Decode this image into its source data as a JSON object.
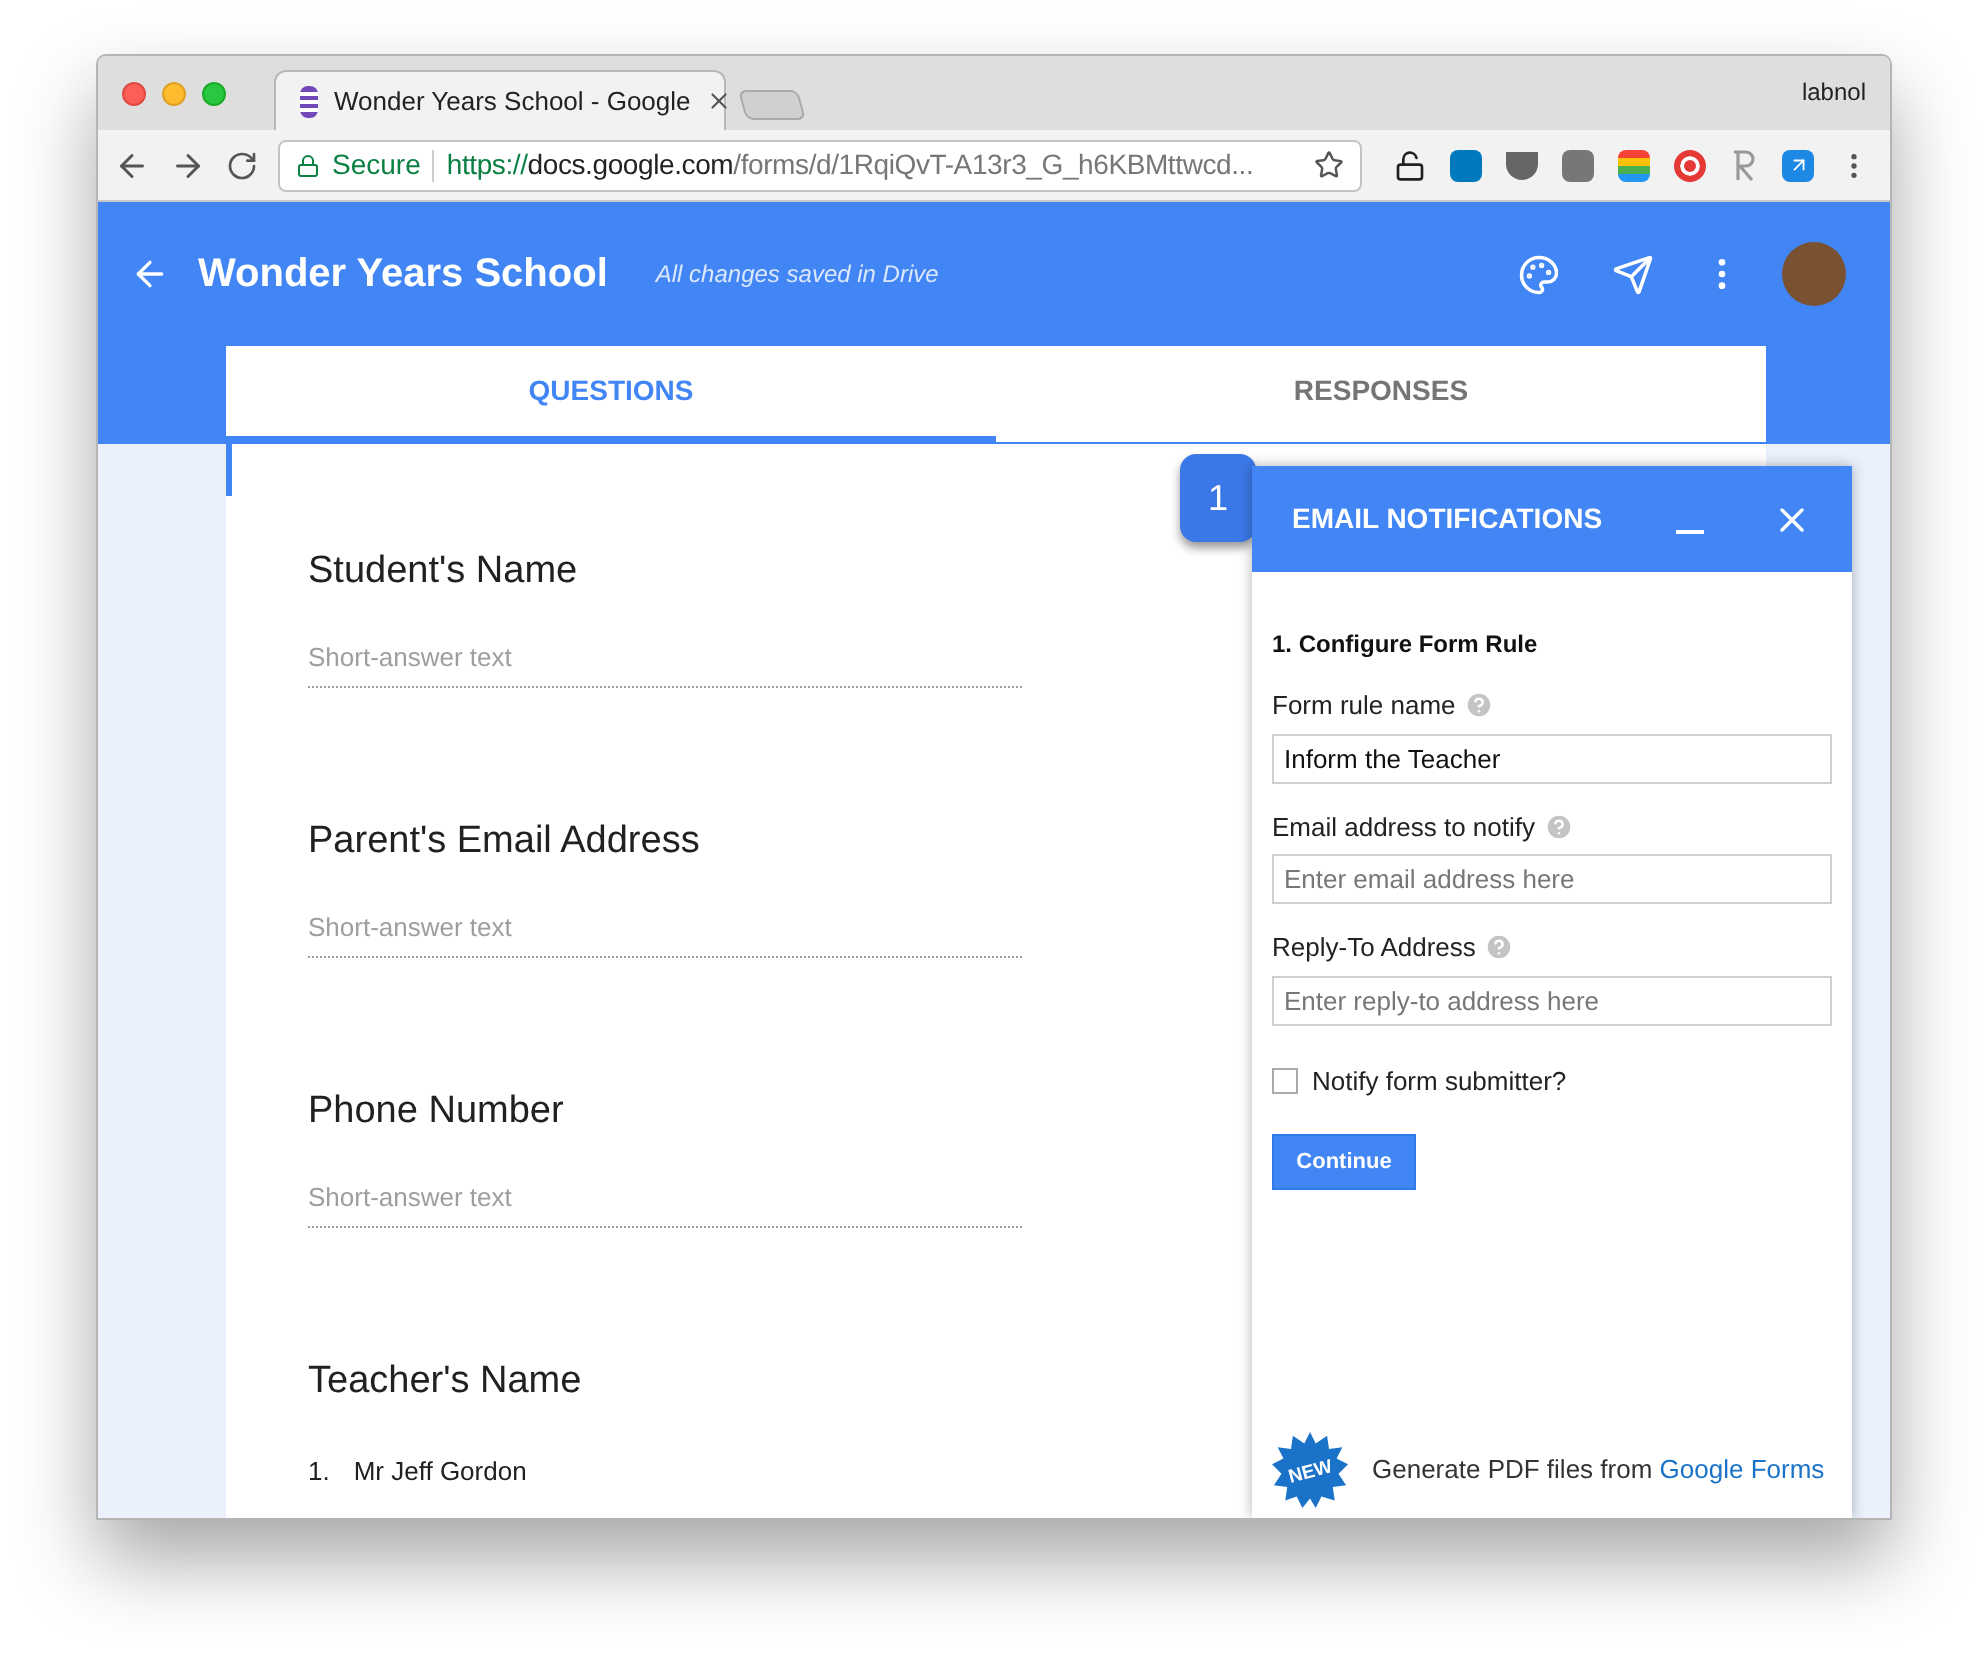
{
  "browser": {
    "tab_title": "Wonder Years School - Google",
    "profile": "labnol",
    "secure_label": "Secure",
    "url_scheme": "https://",
    "url_host": "docs.google.com",
    "url_path": "/forms/d/1RqiQvT-A13r3_G_h6KBMttwcd..."
  },
  "app": {
    "title": "Wonder Years School",
    "save_status": "All changes saved in Drive"
  },
  "tabs": [
    {
      "label": "QUESTIONS",
      "selected": true
    },
    {
      "label": "RESPONSES",
      "selected": false
    }
  ],
  "questions": [
    {
      "kind": "short",
      "title": "Student's Name",
      "placeholder": "Short-answer text"
    },
    {
      "kind": "short",
      "title": "Parent's Email Address",
      "placeholder": "Short-answer text"
    },
    {
      "kind": "short",
      "title": "Phone Number",
      "placeholder": "Short-answer text"
    },
    {
      "kind": "list",
      "title": "Teacher's Name",
      "options": [
        {
          "number": "1.",
          "label": "Mr Jeff Gordon"
        }
      ]
    }
  ],
  "callout": "1",
  "panel": {
    "title": "EMAIL NOTIFICATIONS",
    "section": "1. Configure Form Rule",
    "fields": [
      {
        "label": "Form rule name",
        "value": "Inform the Teacher"
      },
      {
        "label": "Email address to notify",
        "placeholder": "Enter email address here"
      },
      {
        "label": "Reply-To Address",
        "placeholder": "Enter reply-to address here"
      }
    ],
    "checkbox": {
      "label": "Notify form submitter?",
      "checked": false
    },
    "button": "Continue",
    "promo": {
      "badge": "NEW",
      "text": "Generate PDF files from",
      "link": "Google Forms"
    }
  }
}
